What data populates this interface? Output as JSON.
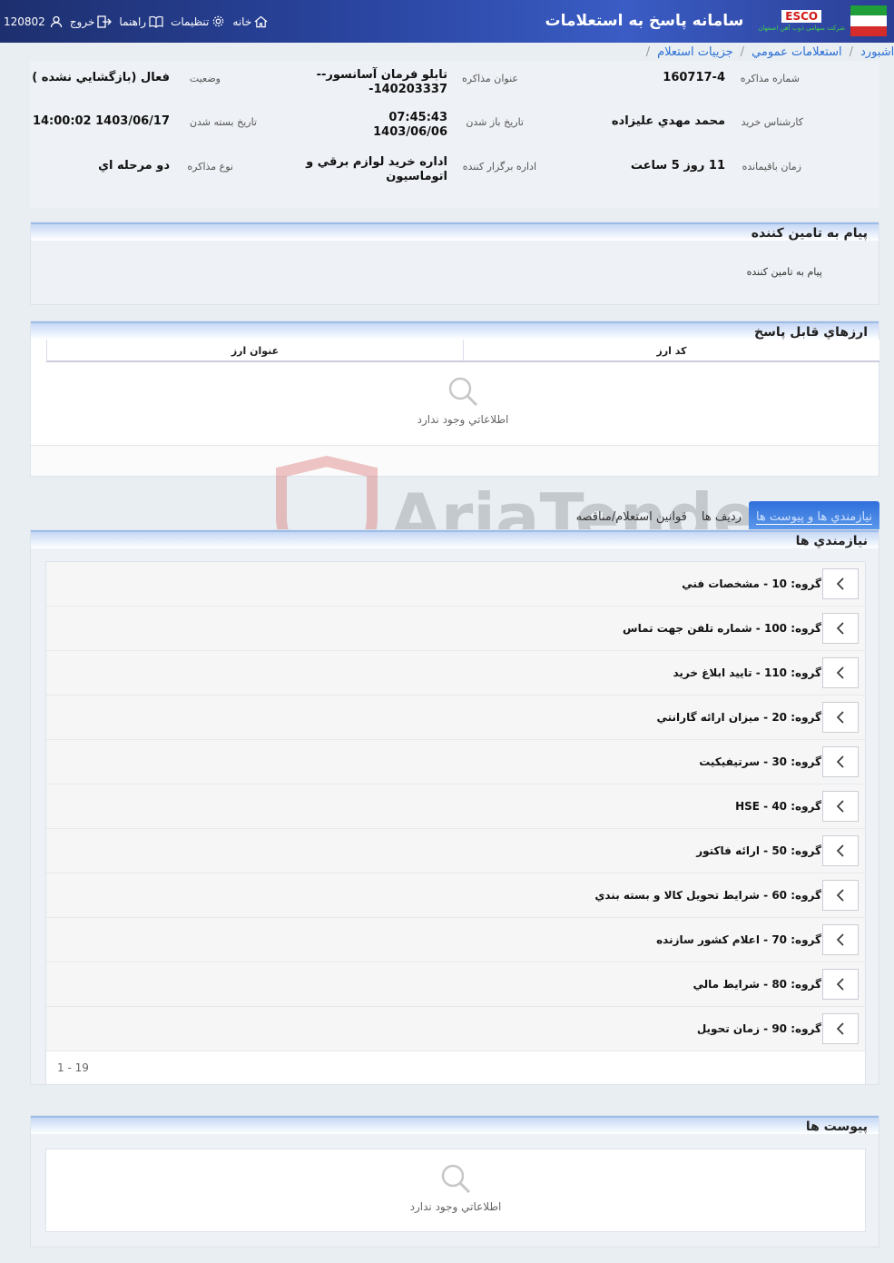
{
  "header": {
    "system_title": "سامانه پاسخ به استعلامات",
    "company_logo": "ESCO",
    "company_sub": "شرکت سهامی ذوب آهن اصفهان",
    "nav": {
      "home": "خانه",
      "settings": "تنظیمات",
      "guide": "راهنما",
      "logout": "خروج",
      "user_id": "120802"
    }
  },
  "breadcrumb": {
    "first": "داشبورد",
    "second": "استعلامات عمومي",
    "current": "جزييات استعلام"
  },
  "info": {
    "number_label": "شماره مذاکره",
    "number_value": "160717-4",
    "title_label": "عنوان مذاکره",
    "title_value_line1": "تابلو فرمان آسانسور--",
    "title_value_line2": "140203337-",
    "status_label": "وضعيت",
    "status_value": "فعال (بازگشايي نشده )",
    "buyer_label": "کارشناس خريد",
    "buyer_value": "محمد مهدي عليزاده",
    "open_date_label": "تاريخ باز شدن",
    "open_date_value_line1": "07:45:43",
    "open_date_value_line2": "1403/06/06",
    "close_date_label": "تاريخ بسته شدن",
    "close_date_value": "1403/06/17 14:00:02",
    "remaining_label": "زمان باقيمانده",
    "remaining_value": "11 روز 5 ساعت",
    "dept_label": "اداره برگزار کننده",
    "dept_value_line1": "اداره خريد لوازم برقي و",
    "dept_value_line2": "اتوماسيون",
    "type_label": "نوع مذاکره",
    "type_value": "دو مرحله اي"
  },
  "message_panel": {
    "title": "پيام به تامين کننده",
    "body": "پيام به تامين کننده"
  },
  "currency_panel": {
    "title": "ارزهاي قابل پاسخ",
    "col_code": "کد ارز",
    "col_name": "عنوان ارز",
    "empty_text": "اطلاعاتي وجود ندارد"
  },
  "tabs": {
    "needs": "نيازمندي ها و پيوست ها",
    "rows": "رديف ها",
    "rules": "قوانين استعلام/مناقصه"
  },
  "needs_panel": {
    "title": "نيازمندي ها",
    "items": [
      "گروه: 10 - مشخصات فني",
      "گروه: 100 - شماره تلفن جهت تماس",
      "گروه: 110 - تاييد ابلاغ خريد",
      "گروه: 20 - ميزان ارائه گارانتي",
      "گروه: 30 - سرتيفيکيت",
      "گروه: 40 - HSE",
      "گروه: 50 - ارائه فاکتور",
      "گروه: 60 - شرايط تحويل کالا و بسته بندي",
      "گروه: 70 - اعلام کشور سازنده",
      "گروه: 80 - شرايط مالي",
      "گروه: 90 - زمان تحويل"
    ],
    "pager": "1 - 19"
  },
  "attachments_panel": {
    "title": "پيوست ها",
    "empty_text": "اطلاعاتي وجود ندارد"
  },
  "watermark": "AriaTender.neT",
  "colors": {
    "header_bg": "#2a45a0",
    "link": "#2a6fd6",
    "tab_active": "#2f6fdb"
  }
}
